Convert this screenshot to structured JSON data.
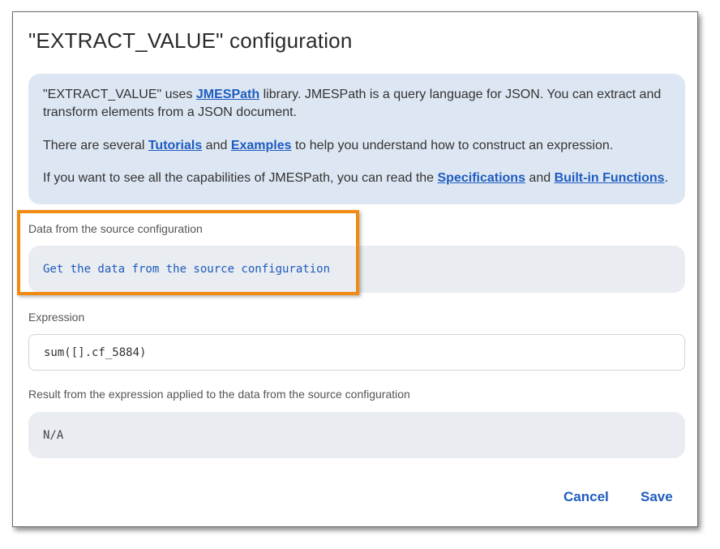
{
  "dialog": {
    "title": "\"EXTRACT_VALUE\" configuration"
  },
  "info": {
    "p1_a": "\"EXTRACT_VALUE\" uses ",
    "p1_link": "JMESPath",
    "p1_b": " library. JMESPath is a query language for JSON. You can extract and transform elements from a JSON document.",
    "p2_a": "There are several ",
    "p2_link1": "Tutorials",
    "p2_b": " and ",
    "p2_link2": "Examples",
    "p2_c": " to help you understand how to construct an expression.",
    "p3_a": "If you want to see all the capabilities of JMESPath, you can read the ",
    "p3_link1": "Specifications",
    "p3_b": " and ",
    "p3_link2": "Built-in Functions",
    "p3_c": "."
  },
  "source": {
    "label": "Data from the source configuration",
    "action": "Get the data from the source configuration"
  },
  "expression": {
    "label": "Expression",
    "value": "sum([].cf_5884)"
  },
  "result": {
    "label": "Result from the expression applied to the data from the source configuration",
    "value": "N/A"
  },
  "buttons": {
    "cancel": "Cancel",
    "save": "Save"
  },
  "colors": {
    "link": "#1e5bbf",
    "info_bg": "#dde7f3",
    "highlight": "#f08a12"
  }
}
